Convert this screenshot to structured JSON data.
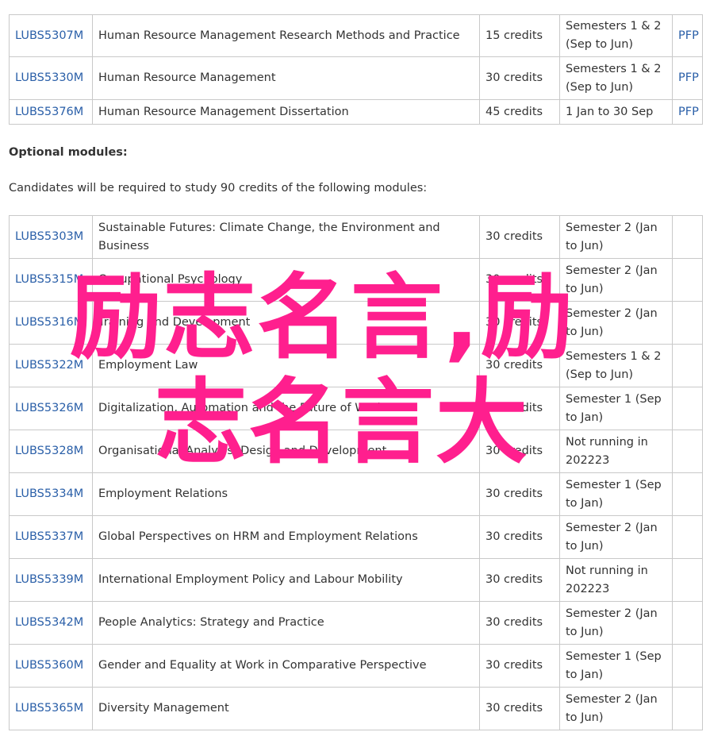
{
  "core_modules": [
    {
      "code": "LUBS5307M",
      "title": "Human Resource Management Research Methods and Practice",
      "credits": "15 credits",
      "period": "Semesters 1 & 2 (Sep to Jun)",
      "type": "PFP"
    },
    {
      "code": "LUBS5330M",
      "title": "Human Resource Management",
      "credits": "30 credits",
      "period": "Semesters 1 & 2 (Sep to Jun)",
      "type": "PFP"
    },
    {
      "code": "LUBS5376M",
      "title": "Human Resource Management Dissertation",
      "credits": "45 credits",
      "period": "1 Jan to 30 Sep",
      "type": "PFP"
    }
  ],
  "optional_heading": "Optional modules:",
  "optional_intro": "Candidates will be required to study 90 credits of the following modules:",
  "optional_modules": [
    {
      "code": "LUBS5303M",
      "title": "Sustainable Futures: Climate Change, the Environment and Business",
      "credits": "30 credits",
      "period": "Semester 2 (Jan to Jun)"
    },
    {
      "code": "LUBS5315M",
      "title": "Occupational Psychology",
      "credits": "30 credits",
      "period": "Semester 2 (Jan to Jun)"
    },
    {
      "code": "LUBS5316M",
      "title": "Training and Development",
      "credits": "30 credits",
      "period": "Semester 2 (Jan to Jun)"
    },
    {
      "code": "LUBS5322M",
      "title": "Employment Law",
      "credits": "30 credits",
      "period": "Semesters 1 & 2 (Sep to Jun)"
    },
    {
      "code": "LUBS5326M",
      "title": "Digitalization, Automation and the Future of Work",
      "credits": "30 credits",
      "period": "Semester 1 (Sep to Jan)"
    },
    {
      "code": "LUBS5328M",
      "title": "Organisational Analysis, Design and Development",
      "credits": "30 credits",
      "period": "Not running in 202223"
    },
    {
      "code": "LUBS5334M",
      "title": "Employment Relations",
      "credits": "30 credits",
      "period": "Semester 1 (Sep to Jan)"
    },
    {
      "code": "LUBS5337M",
      "title": "Global Perspectives on HRM and Employment Relations",
      "credits": "30 credits",
      "period": "Semester 2 (Jan to Jun)"
    },
    {
      "code": "LUBS5339M",
      "title": "International Employment Policy and Labour Mobility",
      "credits": "30 credits",
      "period": "Not running in 202223"
    },
    {
      "code": "LUBS5342M",
      "title": "People Analytics: Strategy and Practice",
      "credits": "30 credits",
      "period": "Semester 2 (Jan to Jun)"
    },
    {
      "code": "LUBS5360M",
      "title": "Gender and Equality at Work in Comparative Perspective",
      "credits": "30 credits",
      "period": "Semester 1 (Sep to Jan)"
    },
    {
      "code": "LUBS5365M",
      "title": "Diversity Management",
      "credits": "30 credits",
      "period": "Semester 2 (Jan to Jun)"
    }
  ],
  "watermark": {
    "line1": "励志名言,励",
    "line2": "志名言大",
    "color": "#ff1f8e"
  },
  "colors": {
    "link": "#2a5fa8",
    "border": "#c9c9c9",
    "text": "#333333"
  }
}
